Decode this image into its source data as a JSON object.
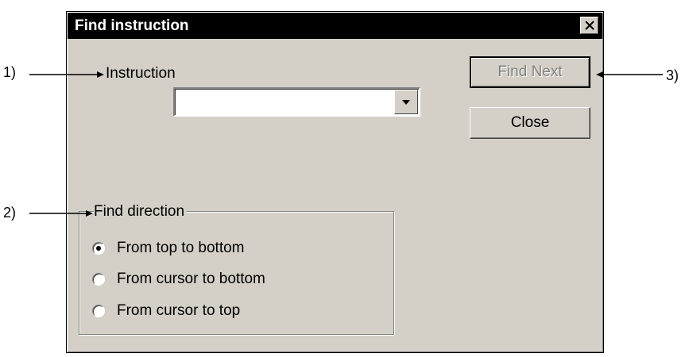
{
  "dialog": {
    "title": "Find instruction",
    "instruction_label": "Instruction",
    "instruction_value": "",
    "find_next_label": "Find Next",
    "close_label": "Close",
    "group_title": "Find direction",
    "directions": [
      {
        "label": "From top to bottom",
        "checked": true
      },
      {
        "label": "From cursor to bottom",
        "checked": false
      },
      {
        "label": "From cursor to top",
        "checked": false
      }
    ]
  },
  "callouts": [
    "1)",
    "2)",
    "3)"
  ]
}
